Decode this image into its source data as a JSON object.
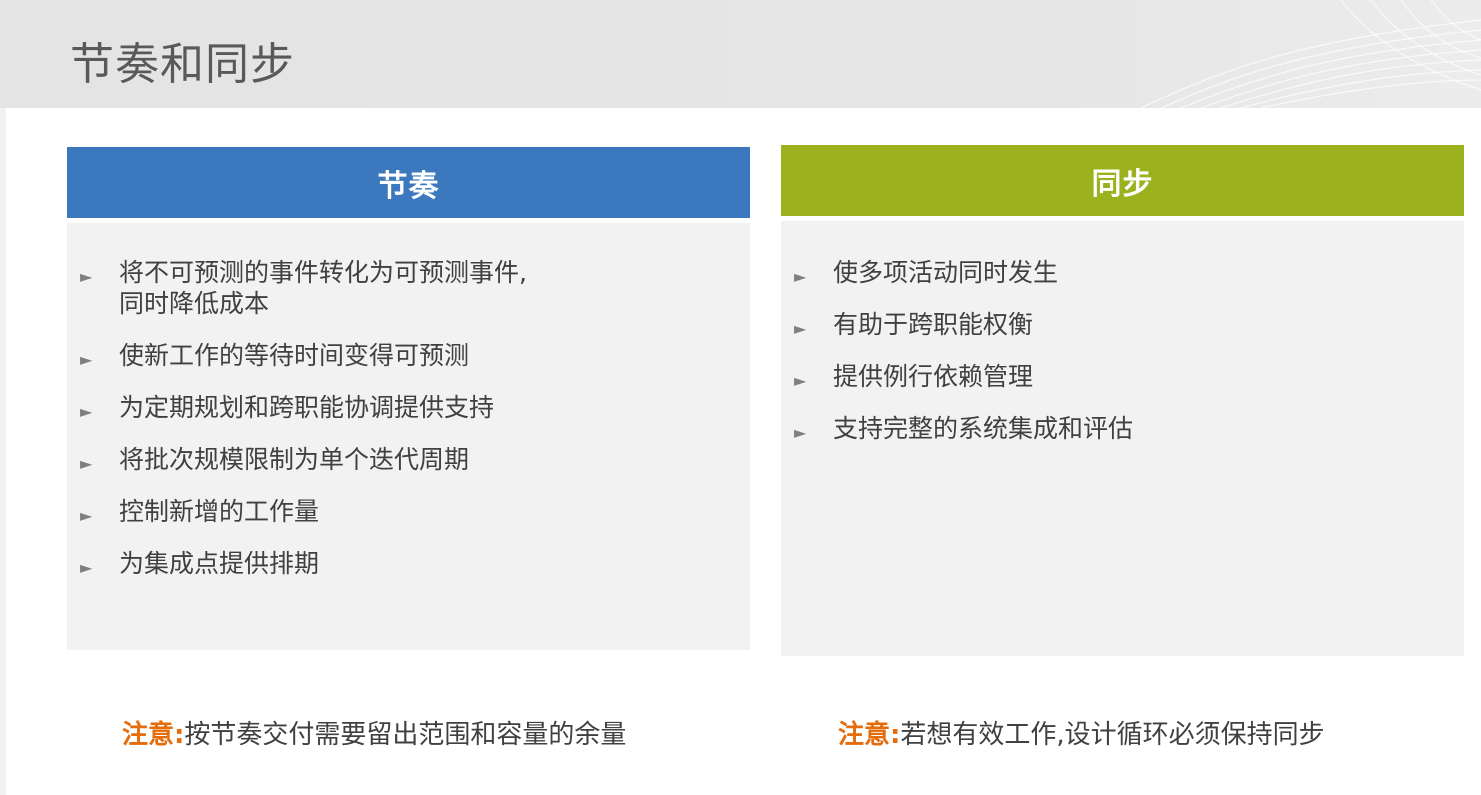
{
  "header": {
    "title": "节奏和同步"
  },
  "left_panel": {
    "heading": "节奏",
    "accent_color": "#3b78be",
    "items": [
      {
        "line1": "将不可预测的事件转化为可预测事件,",
        "line2": "同时降低成本"
      },
      {
        "line1": "使新工作的等待时间变得可预测"
      },
      {
        "line1": "为定期规划和跨职能协调提供支持"
      },
      {
        "line1": "将批次规模限制为单个迭代周期"
      },
      {
        "line1": "控制新增的工作量"
      },
      {
        "line1": "为集成点提供排期"
      }
    ]
  },
  "right_panel": {
    "heading": "同步",
    "accent_color": "#9bb11e",
    "items": [
      {
        "line1": "使多项活动同时发生"
      },
      {
        "line1": "有助于跨职能权衡"
      },
      {
        "line1": "提供例行依赖管理"
      },
      {
        "line1": "支持完整的系统集成和评估"
      }
    ]
  },
  "notes": {
    "label_color": "#e46c0a",
    "left": {
      "label": "注意:",
      "text": "按节奏交付需要留出范围和容量的余量"
    },
    "right": {
      "label": "注意:",
      "text": "若想有效工作,设计循环必须保持同步"
    }
  },
  "icons": {
    "bullet": "triangle-right-icon"
  }
}
